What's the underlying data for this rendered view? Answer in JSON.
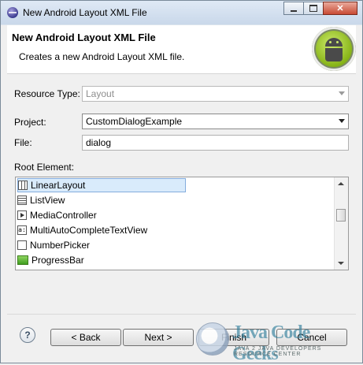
{
  "window": {
    "title": "New Android Layout XML File"
  },
  "header": {
    "title": "New Android Layout XML File",
    "description": "Creates a new Android Layout XML file."
  },
  "form": {
    "resource_type_label": "Resource Type:",
    "resource_type_value": "Layout",
    "project_label": "Project:",
    "project_value": "CustomDialogExample",
    "file_label": "File:",
    "file_value": "dialog",
    "root_element_label": "Root Element:"
  },
  "root_elements": [
    {
      "label": "LinearLayout",
      "icon": "linear-layout-icon",
      "selected": true
    },
    {
      "label": "ListView",
      "icon": "list-view-icon",
      "selected": false
    },
    {
      "label": "MediaController",
      "icon": "media-controller-icon",
      "selected": false
    },
    {
      "label": "MultiAutoCompleteTextView",
      "icon": "multi-autocomplete-icon",
      "selected": false
    },
    {
      "label": "NumberPicker",
      "icon": "number-picker-icon",
      "selected": false
    },
    {
      "label": "ProgressBar",
      "icon": "progress-bar-icon",
      "selected": false
    }
  ],
  "buttons": {
    "help": "?",
    "back": "< Back",
    "next": "Next >",
    "finish": "Finish",
    "cancel": "Cancel"
  },
  "watermark": {
    "brand": "Java Code Geeks",
    "tagline": "JAVA 2 JAVA DEVELOPERS RESOURCE CENTER"
  }
}
